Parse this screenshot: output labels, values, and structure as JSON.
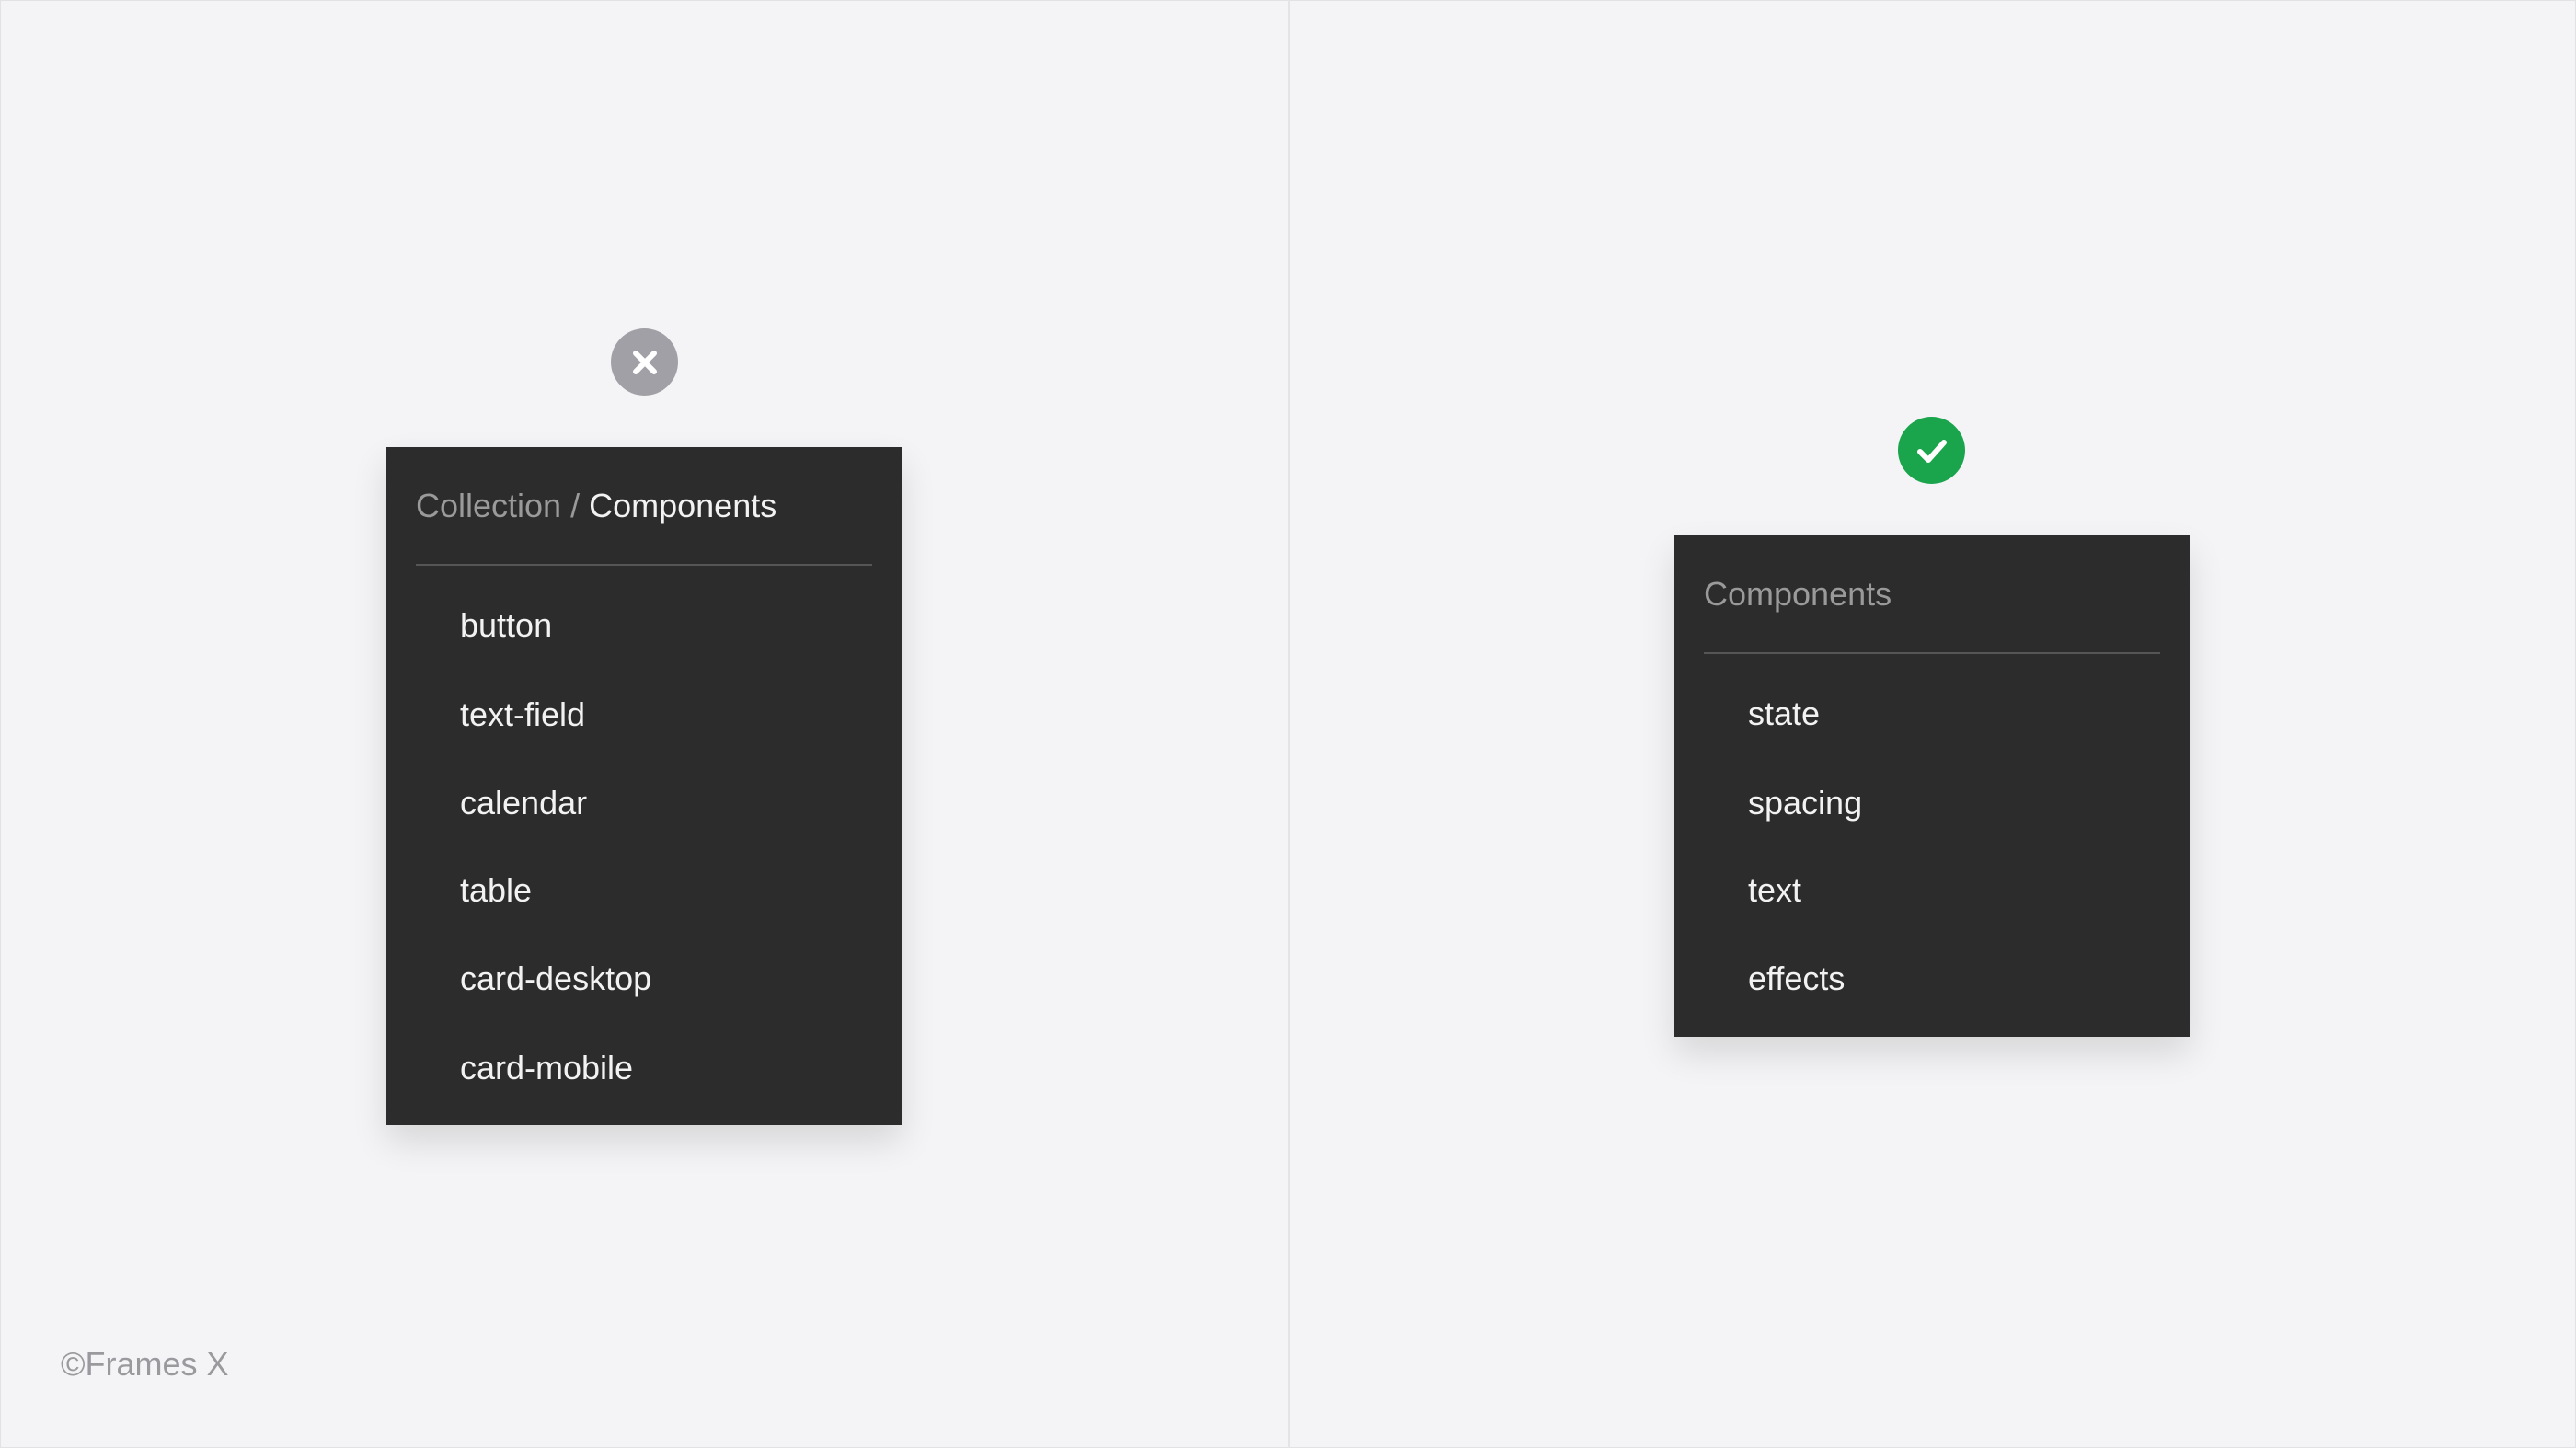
{
  "left": {
    "status_icon": "x-circle-icon",
    "status_color": "#a0a0a6",
    "header_parent": "Collection",
    "header_sep": " / ",
    "header_current": "Components",
    "items": [
      "button",
      "text-field",
      "calendar",
      "table",
      "card-desktop",
      "card-mobile"
    ]
  },
  "right": {
    "status_icon": "check-circle-icon",
    "status_color": "#1aa44c",
    "header": "Components",
    "items": [
      "state",
      "spacing",
      "text",
      "effects"
    ]
  },
  "footer": {
    "copyright": "©Frames X"
  }
}
